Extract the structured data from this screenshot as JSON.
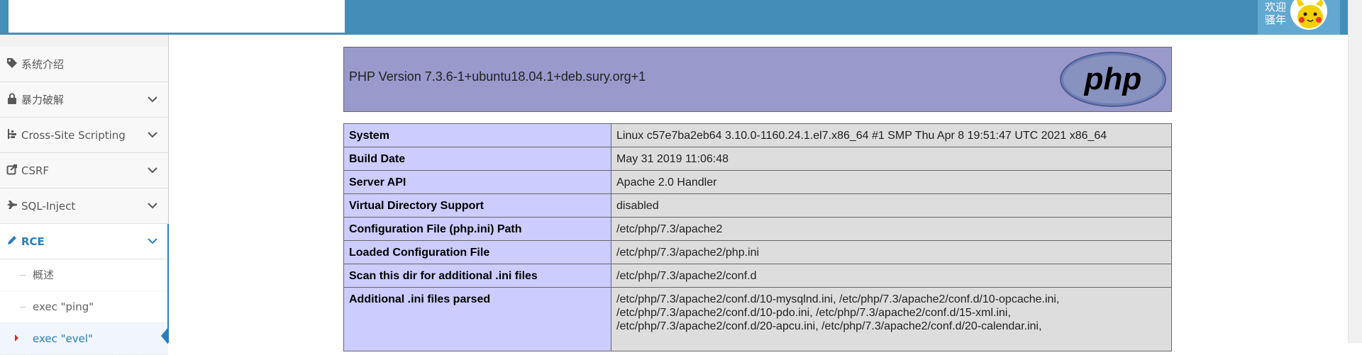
{
  "header": {
    "user_welcome_line1": "欢迎",
    "user_welcome_line2": "骚年"
  },
  "sidebar": {
    "items": [
      {
        "label": "系统介绍",
        "icon": "tag-icon"
      },
      {
        "label": "暴力破解",
        "icon": "lock-icon"
      },
      {
        "label": "Cross-Site Scripting",
        "icon": "sitemap-icon"
      },
      {
        "label": "CSRF",
        "icon": "share-icon"
      },
      {
        "label": "SQL-Inject",
        "icon": "fighter-jet-icon"
      },
      {
        "label": "RCE",
        "icon": "pencil-icon"
      }
    ],
    "sub_items": [
      {
        "label": "概述"
      },
      {
        "label": "exec \"ping\""
      },
      {
        "label": "exec \"evel\""
      }
    ]
  },
  "phpinfo": {
    "version_title": "PHP Version 7.3.6-1+ubuntu18.04.1+deb.sury.org+1",
    "logo_text": "php",
    "rows": [
      {
        "key": "System",
        "value": "Linux c57e7ba2eb64 3.10.0-1160.24.1.el7.x86_64 #1 SMP Thu Apr 8 19:51:47 UTC 2021 x86_64"
      },
      {
        "key": "Build Date",
        "value": "May 31 2019 11:06:48"
      },
      {
        "key": "Server API",
        "value": "Apache 2.0 Handler"
      },
      {
        "key": "Virtual Directory Support",
        "value": "disabled"
      },
      {
        "key": "Configuration File (php.ini) Path",
        "value": "/etc/php/7.3/apache2"
      },
      {
        "key": "Loaded Configuration File",
        "value": "/etc/php/7.3/apache2/php.ini"
      },
      {
        "key": "Scan this dir for additional .ini files",
        "value": "/etc/php/7.3/apache2/conf.d"
      },
      {
        "key": "Additional .ini files parsed",
        "value_lines": [
          "/etc/php/7.3/apache2/conf.d/10-mysqlnd.ini, /etc/php/7.3/apache2/conf.d/10-opcache.ini,",
          "/etc/php/7.3/apache2/conf.d/10-pdo.ini, /etc/php/7.3/apache2/conf.d/15-xml.ini,",
          "/etc/php/7.3/apache2/conf.d/20-apcu.ini, /etc/php/7.3/apache2/conf.d/20-calendar.ini,"
        ]
      }
    ]
  },
  "colors": {
    "topbar": "#438eb9",
    "accent": "#2b7dbc",
    "php_header": "#9999cc",
    "php_key_cell": "#ccccff",
    "php_value_cell": "#dddddd"
  }
}
